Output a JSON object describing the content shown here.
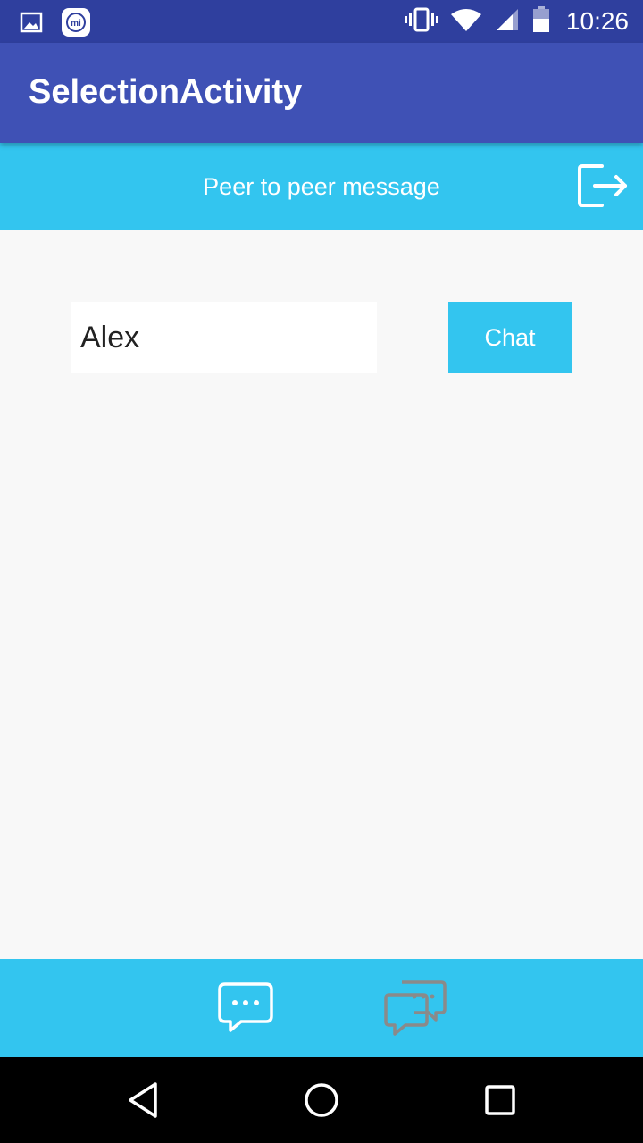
{
  "status_bar": {
    "time": "10:26",
    "left_icons": [
      "image-icon",
      "mi-icon"
    ],
    "right_icons": [
      "vibrate-icon",
      "wifi-icon",
      "signal-icon",
      "battery-icon"
    ]
  },
  "app_bar": {
    "title": "SelectionActivity"
  },
  "sub_header": {
    "title": "Peer to peer message",
    "action_icon": "logout-icon"
  },
  "form": {
    "name_value": "Alex",
    "chat_label": "Chat"
  },
  "bottom_tabs": [
    {
      "icon": "chat-bubble-icon",
      "state": "selected"
    },
    {
      "icon": "group-chat-icon",
      "state": "unselected"
    }
  ],
  "nav_bar": {
    "buttons": [
      "back-icon",
      "home-icon",
      "recent-apps-icon"
    ]
  },
  "colors": {
    "status_bar": "#2f3f9e",
    "app_bar": "#3f51b5",
    "accent": "#33c5ef",
    "background": "#f8f8f8",
    "tab_unselected": "#8a8a8a"
  }
}
